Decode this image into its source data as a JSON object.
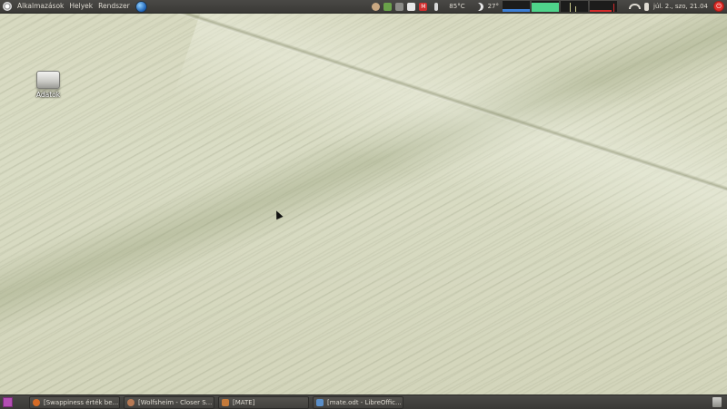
{
  "top_panel": {
    "menu": [
      "Alkalmazások",
      "Helyek",
      "Rendszer"
    ],
    "temperature_cpu": "85°C",
    "temperature_weather": "27°",
    "clock": "júl. 2., szo, 21.04",
    "icons": [
      "ubuntu-logo",
      "globe-icon",
      "pidgin-icon",
      "update-icon",
      "network-icon",
      "dropbox-icon",
      "gmail-icon",
      "thermometer-icon",
      "moon-icon",
      "system-monitor",
      "wifi-icon",
      "volume-icon",
      "power-icon"
    ]
  },
  "desktop": {
    "icons": [
      {
        "label": "Adatok",
        "icon": "drive-icon"
      }
    ]
  },
  "bottom_panel": {
    "tasks": [
      {
        "label": "[Swappiness érték be...",
        "icon": "firefox-icon",
        "color": "#d56b27"
      },
      {
        "label": "[Wolfsheim - Closer S...",
        "icon": "music-icon",
        "color": "#b77a55"
      },
      {
        "label": "[MATE]",
        "icon": "folder-icon",
        "color": "#c47a3a"
      },
      {
        "label": "[mate.odt - LibreOffic...",
        "icon": "document-icon",
        "color": "#5b8fc9"
      }
    ]
  }
}
